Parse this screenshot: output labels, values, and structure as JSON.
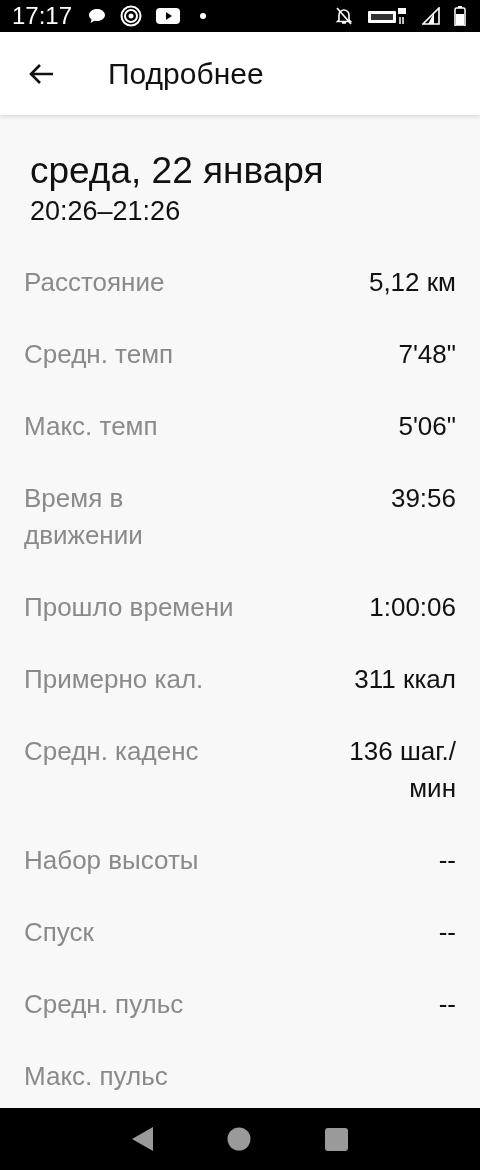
{
  "status_bar": {
    "time": "17:17"
  },
  "app_bar": {
    "title": "Подробнее"
  },
  "header": {
    "date": "среда, 22 января",
    "time_range": "20:26–21:26"
  },
  "stats": [
    {
      "label": "Расстояние",
      "value": "5,12 км"
    },
    {
      "label": "Средн. темп",
      "value": "7'48\""
    },
    {
      "label": "Макс. темп",
      "value": "5'06\""
    },
    {
      "label": "Время в движении",
      "value": "39:56"
    },
    {
      "label": "Прошло времени",
      "value": "1:00:06"
    },
    {
      "label": "Примерно кал.",
      "value": "311 ккал"
    },
    {
      "label": "Средн. каденс",
      "value": "136 шаг./ мин"
    },
    {
      "label": "Набор высоты",
      "value": "--"
    },
    {
      "label": "Спуск",
      "value": "--"
    },
    {
      "label": "Средн. пульс",
      "value": "--"
    },
    {
      "label": "Макс. пульс"
    }
  ]
}
